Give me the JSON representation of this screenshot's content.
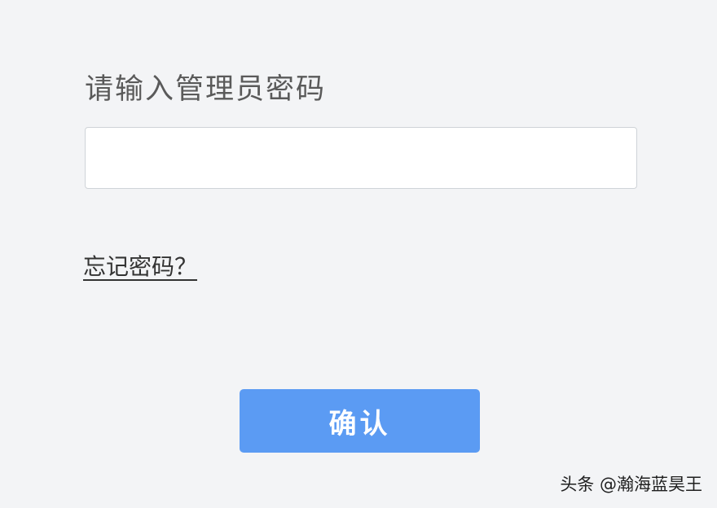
{
  "login": {
    "title": "请输入管理员密码",
    "password_value": "",
    "password_placeholder": "",
    "forgot_link": "忘记密码？",
    "confirm_label": "确认"
  },
  "watermark": {
    "text": "头条 @瀚海蓝昊王"
  },
  "colors": {
    "background": "#f3f4f6",
    "button": "#5b9bf3",
    "title_text": "#5a5a5a"
  }
}
